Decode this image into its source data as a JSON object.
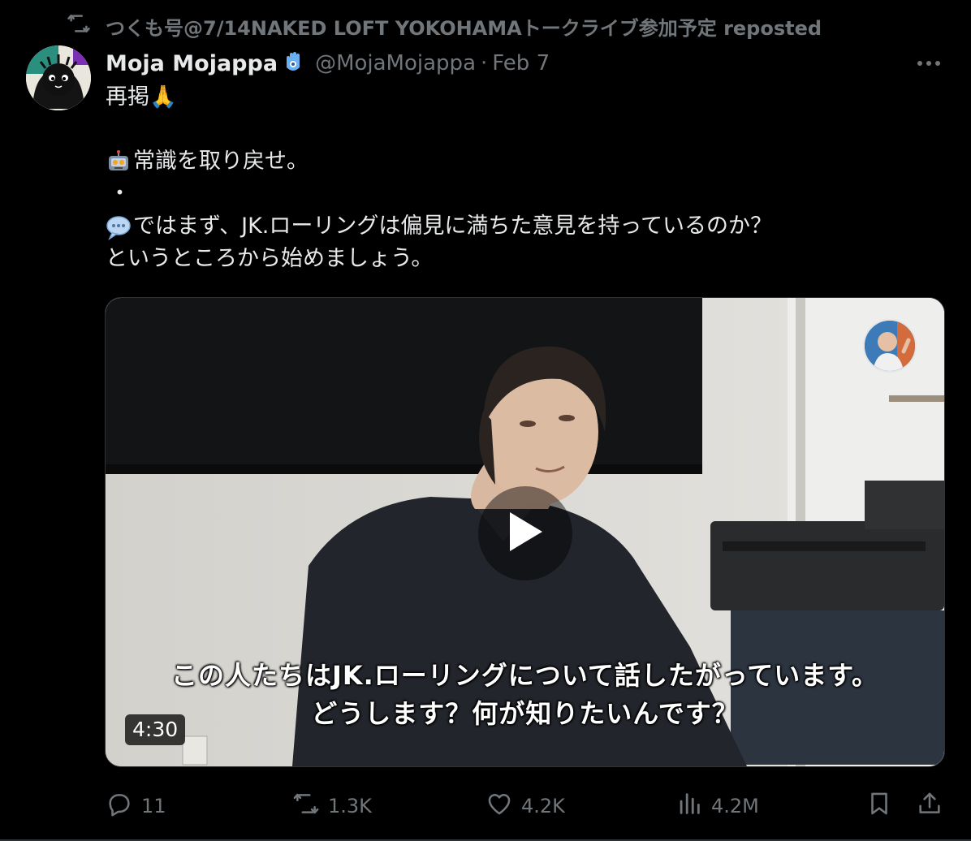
{
  "repost": {
    "icon": "repost-icon",
    "text": "つくも号@7/14NAKED LOFT YOKOHAMAトークライブ参加予定 reposted"
  },
  "author": {
    "name": "Moja Mojappa",
    "badge_icon": "hamsa-icon",
    "handle": "@MojaMojappa",
    "separator": "·",
    "date": "Feb 7"
  },
  "post": {
    "lines": [
      {
        "emoji": "folded-hands-emoji",
        "text": "再掲🙏"
      },
      {
        "emoji": "robot-emoji",
        "text": "常識を取り戻せ。"
      },
      {
        "emoji": "",
        "text": "・"
      },
      {
        "emoji": "speech-bubble-emoji",
        "text": "ではまず、JK.ローリングは偏見に満ちた意見を持っているのか？"
      },
      {
        "emoji": "",
        "text": "というところから始めましょう。"
      }
    ]
  },
  "media": {
    "type": "video",
    "subtitle_line1": "この人たちはJK.ローリングについて話したがっています。",
    "subtitle_line2": "どうします？何が知りたいんです？",
    "duration": "4:30",
    "play_icon": "play-icon"
  },
  "actions": {
    "replies": "11",
    "reposts": "1.3K",
    "likes": "4.2K",
    "views": "4.2M"
  },
  "colors": {
    "background": "#000000",
    "primary_text": "#e7e9ea",
    "secondary_text": "#71767b",
    "divider": "#2f3336"
  }
}
